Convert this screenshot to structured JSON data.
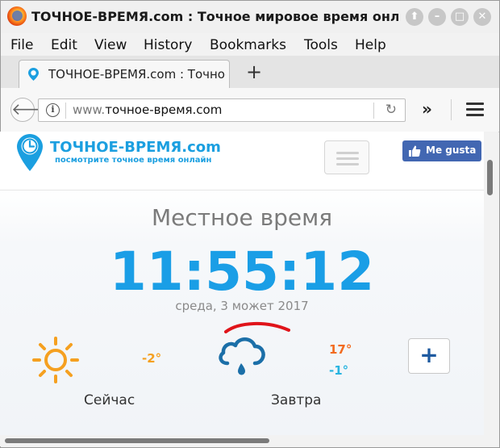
{
  "window": {
    "title": "ТОЧНОЕ-ВРЕМЯ.com : Точное мировое время онлайн",
    "controls": [
      "⬆",
      "–",
      "□",
      "✕"
    ]
  },
  "menu": [
    "File",
    "Edit",
    "View",
    "History",
    "Bookmarks",
    "Tools",
    "Help"
  ],
  "tab": {
    "label": "ТОЧНОЕ-ВРЕМЯ.com : Точное",
    "new_tab": "+"
  },
  "address": {
    "prefix": "www.",
    "domain": "точное-время.com"
  },
  "site": {
    "logo_name": "ТОЧНОЕ-ВРЕМЯ.com",
    "logo_tagline": "посмотрите точное время онлайн",
    "like_label": "Me gusta"
  },
  "clock": {
    "heading": "Местное время",
    "time": "11:55:12",
    "date": "среда, 3 мoжет 2017"
  },
  "weather": {
    "now_temp": "-2°",
    "now_label": "Сейчас",
    "tomorrow_high": "17°",
    "tomorrow_low": "-1°",
    "tomorrow_label": "Завтра",
    "add_label": "+"
  },
  "colors": {
    "accent": "#1a9ee6",
    "sun": "#f5a020",
    "cloud": "#1b6fa8",
    "high": "#f26b20",
    "low": "#28b4e0",
    "facebook": "#4267b2"
  }
}
